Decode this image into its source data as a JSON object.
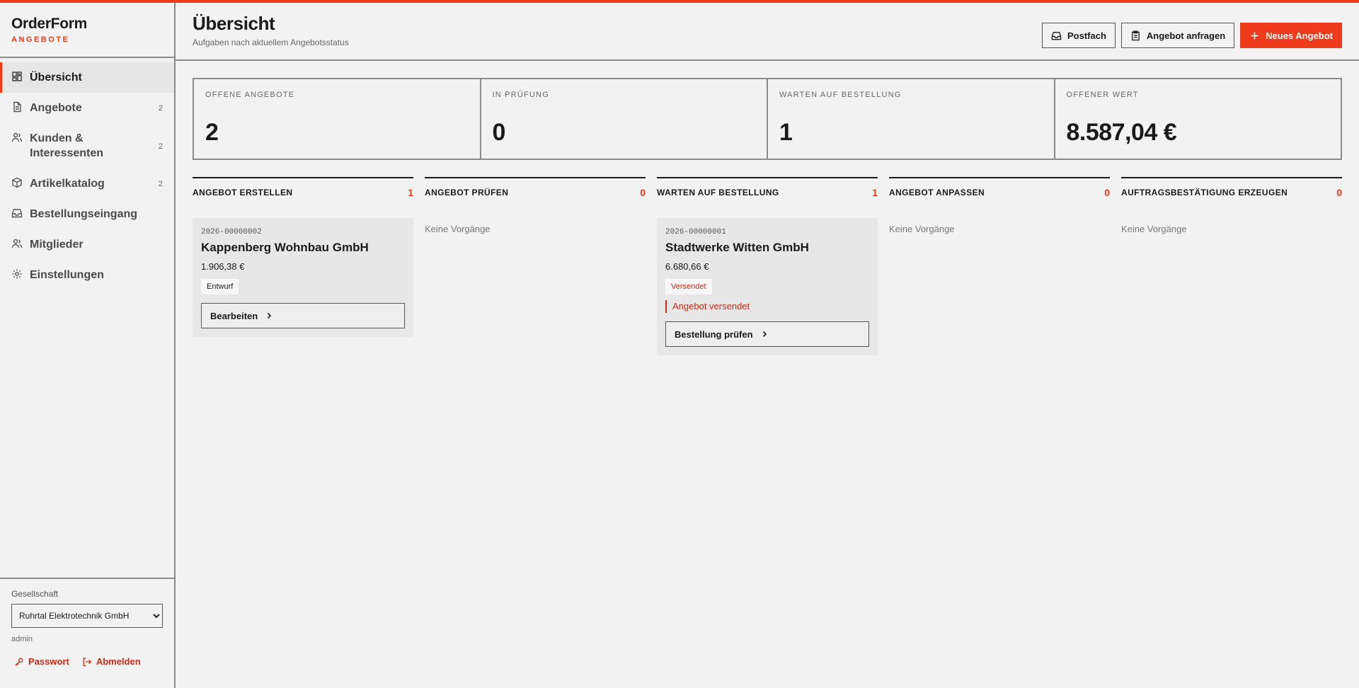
{
  "brand": {
    "name": "OrderForm",
    "sub": "ANGEBOTE"
  },
  "colors": {
    "accent": "#ee3b1c",
    "accent_dark": "#cc2a12"
  },
  "nav": [
    {
      "label": "Übersicht",
      "icon": "dashboard-icon",
      "count": "",
      "active": true
    },
    {
      "label": "Angebote",
      "icon": "document-icon",
      "count": "2"
    },
    {
      "label": "Kunden & Interessenten",
      "icon": "users-icon",
      "count": "2"
    },
    {
      "label": "Artikelkatalog",
      "icon": "box-icon",
      "count": "2"
    },
    {
      "label": "Bestellungseingang",
      "icon": "inbox-icon",
      "count": ""
    },
    {
      "label": "Mitglieder",
      "icon": "users-icon",
      "count": ""
    },
    {
      "label": "Einstellungen",
      "icon": "gear-icon",
      "count": ""
    }
  ],
  "sidebar_bottom": {
    "company_label": "Gesellschaft",
    "company_value": "Ruhrtal Elektrotechnik GmbH",
    "user": "admin",
    "password_label": "Passwort",
    "logout_label": "Abmelden"
  },
  "header": {
    "title": "Übersicht",
    "subtitle": "Aufgaben nach aktuellem Angebotsstatus",
    "inbox_label": "Postfach",
    "request_label": "Angebot anfragen",
    "new_label": "Neues Angebot"
  },
  "kpis": [
    {
      "label": "OFFENE ANGEBOTE",
      "value": "2"
    },
    {
      "label": "IN PRÜFUNG",
      "value": "0"
    },
    {
      "label": "WARTEN AUF BESTELLUNG",
      "value": "1"
    },
    {
      "label": "OFFENER WERT",
      "value": "8.587,04 €"
    }
  ],
  "empty_label": "Keine Vorgänge",
  "columns": [
    {
      "title": "ANGEBOT ERSTELLEN",
      "count": "1",
      "card": {
        "id": "2026-00000002",
        "company": "Kappenberg Wohnbau GmbH",
        "amount": "1.906,38 €",
        "badge": "Entwurf",
        "button": "Bearbeiten"
      }
    },
    {
      "title": "ANGEBOT PRÜFEN",
      "count": "0"
    },
    {
      "title": "WARTEN AUF BESTELLUNG",
      "count": "1",
      "card": {
        "id": "2026-00000001",
        "company": "Stadtwerke Witten GmbH",
        "amount": "6.680,66 €",
        "badge": "Versendet",
        "note": "Angebot versendet",
        "button": "Bestellung prüfen"
      }
    },
    {
      "title": "ANGEBOT ANPASSEN",
      "count": "0"
    },
    {
      "title": "AUFTRAGSBESTÄTIGUNG ERZEUGEN",
      "count": "0"
    }
  ]
}
